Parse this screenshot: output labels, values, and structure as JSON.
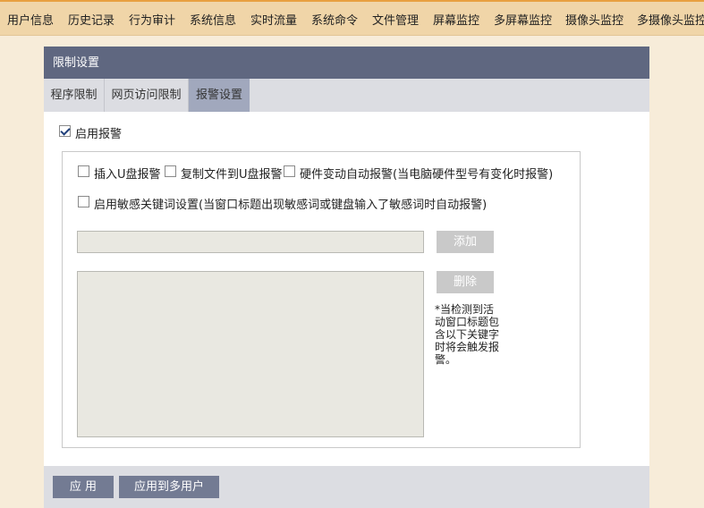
{
  "topnav": {
    "items": [
      "用户信息",
      "历史记录",
      "行为审计",
      "系统信息",
      "实时流量",
      "系统命令",
      "文件管理",
      "屏幕监控",
      "多屏幕监控",
      "摄像头监控",
      "多摄像头监控"
    ]
  },
  "panel": {
    "title": "限制设置",
    "tabs": [
      {
        "label": "程序限制",
        "active": false
      },
      {
        "label": "网页访问限制",
        "active": false
      },
      {
        "label": "报警设置",
        "active": true
      }
    ]
  },
  "alarm": {
    "enable_label": "启用报警",
    "enable_checked": true,
    "options": [
      {
        "label": "插入U盘报警",
        "checked": false
      },
      {
        "label": "复制文件到U盘报警",
        "checked": false
      },
      {
        "label": "硬件变动自动报警(当电脑硬件型号有变化时报警)",
        "checked": false
      }
    ],
    "keyword_option": {
      "label": "启用敏感关键词设置(当窗口标题出现敏感词或键盘输入了敏感词时自动报警)",
      "checked": false
    },
    "keyword_input_value": "",
    "add_label": "添加",
    "delete_label": "删除",
    "hint_lines": [
      "*当检测到活",
      "动窗口标题包",
      "含以下关键字",
      "时将会触发报",
      "警。"
    ]
  },
  "footer": {
    "apply_label": "应 用",
    "apply_multi_label": "应用到多用户"
  }
}
